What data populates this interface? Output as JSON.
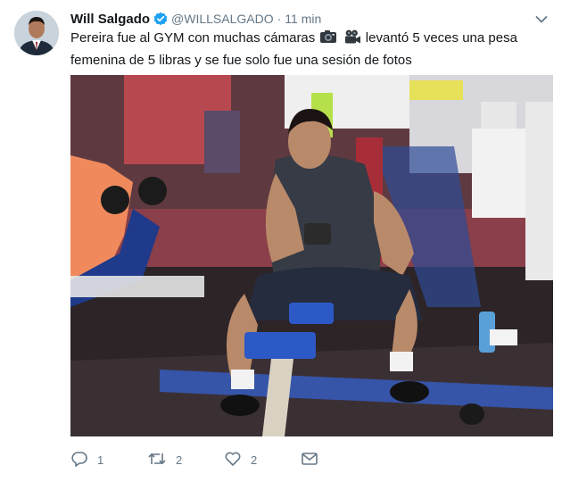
{
  "tweet": {
    "author_name": "Will Salgado",
    "handle": "@WILLSALGADO",
    "separator": "·",
    "time": "11 min",
    "text_before_emoji": "Pereira fue al GYM con muchas cámaras",
    "text_after_emoji": "levantó 5 veces una pesa femenina de 5 libras y se fue solo fue una sesión de fotos",
    "icons": [
      "verified-badge-icon",
      "camera-icon",
      "movie-camera-icon",
      "chevron-down-icon"
    ],
    "image": {
      "depicts": "gym-photo"
    }
  },
  "actions": {
    "reply_count": "1",
    "retweet_count": "2",
    "like_count": "2"
  },
  "colors": {
    "verified": "#1da1f2",
    "meta_text": "#657786",
    "body_text": "#14171a"
  }
}
